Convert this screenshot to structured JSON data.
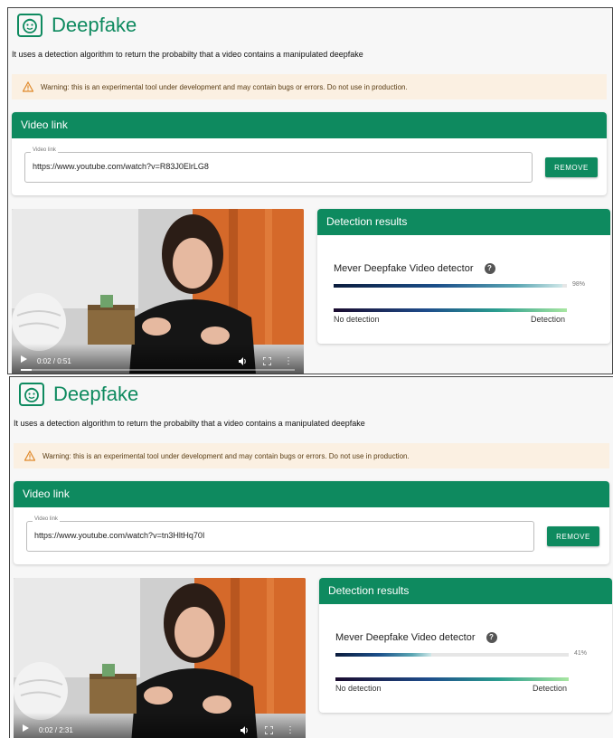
{
  "colors": {
    "brand": "#0e8a5f",
    "warning_bg": "#fbf0e2"
  },
  "panels": [
    {
      "title": "Deepfake",
      "description": "It uses a detection algorithm to return the probabilty that a video contains a manipulated deepfake",
      "warning": "Warning: this is an experimental tool under development and may contain bugs or errors. Do not use in production.",
      "link_card": {
        "title": "Video link",
        "field_label": "Video link",
        "url": "https://www.youtube.com/watch?v=R83J0ElrLG8",
        "remove_label": "REMOVE"
      },
      "video": {
        "time": "0:02 / 0:51",
        "progress": 0.04
      },
      "results": {
        "title": "Detection results",
        "detector": "Mever Deepfake Video detector",
        "help": "?",
        "percent_label": "98%",
        "score": 0.98,
        "scale_left": "No detection",
        "scale_right": "Detection"
      }
    },
    {
      "title": "Deepfake",
      "description": "It uses a detection algorithm to return the probabilty that a video contains a manipulated deepfake",
      "warning": "Warning: this is an experimental tool under development and may contain bugs or errors. Do not use in production.",
      "link_card": {
        "title": "Video link",
        "field_label": "Video link",
        "url": "https://www.youtube.com/watch?v=tn3HltHq70I",
        "remove_label": "REMOVE"
      },
      "video": {
        "time": "0:02 / 2:31",
        "progress": 0.02
      },
      "results": {
        "title": "Detection results",
        "detector": "Mever Deepfake Video detector",
        "help": "?",
        "percent_label": "41%",
        "score": 0.41,
        "scale_left": "No detection",
        "scale_right": "Detection"
      }
    }
  ]
}
